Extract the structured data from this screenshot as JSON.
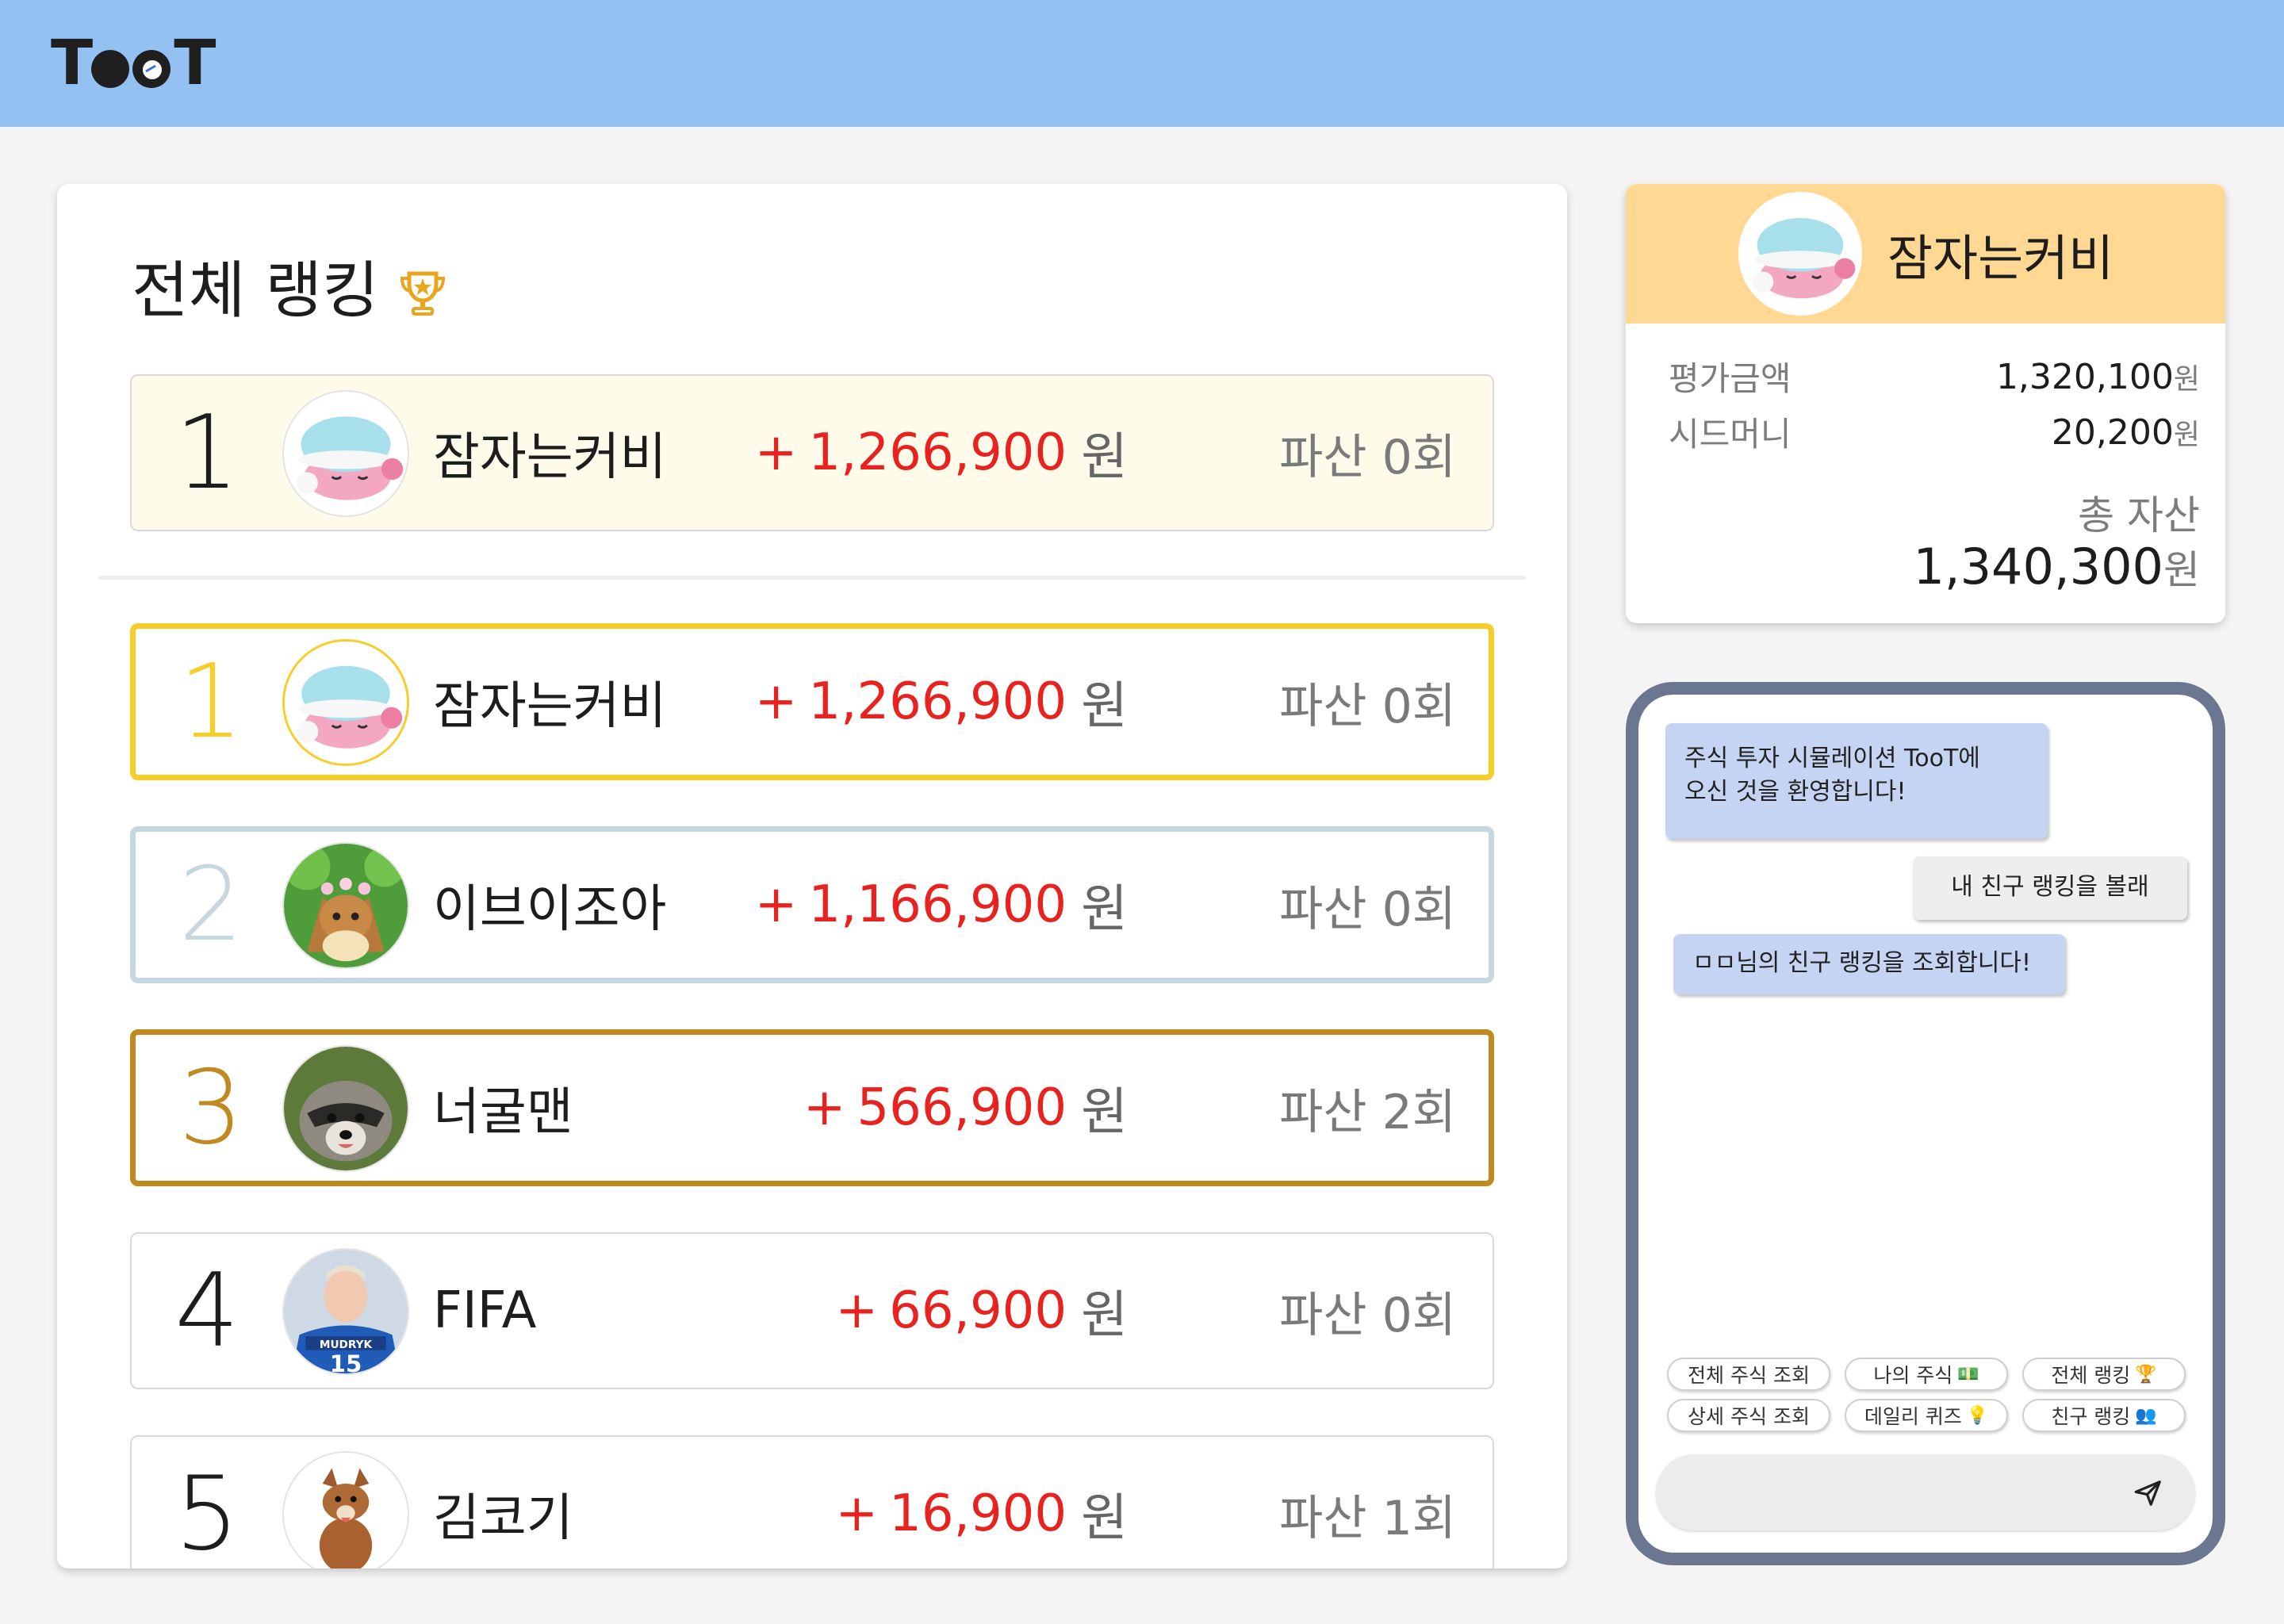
{
  "app": {
    "logo_text": "TooT"
  },
  "ranking": {
    "title": "전체 랭킹",
    "my_rank": {
      "rank": "1",
      "name": "잠자는커비",
      "plus": "+",
      "profit": "1,266,900",
      "unit": "원",
      "bankrupt": "파산 0회"
    },
    "rows": [
      {
        "rank": "1",
        "name": "잠자는커비",
        "plus": "+",
        "profit": "1,266,900",
        "unit": "원",
        "bankrupt": "파산 0회"
      },
      {
        "rank": "2",
        "name": "이브이조아",
        "plus": "+",
        "profit": "1,166,900",
        "unit": "원",
        "bankrupt": "파산 0회"
      },
      {
        "rank": "3",
        "name": "너굴맨",
        "plus": "+",
        "profit": "566,900",
        "unit": "원",
        "bankrupt": "파산 2회"
      },
      {
        "rank": "4",
        "name": "FIFA",
        "plus": "+",
        "profit": "66,900",
        "unit": "원",
        "bankrupt": "파산 0회"
      },
      {
        "rank": "5",
        "name": "김코기",
        "plus": "+",
        "profit": "16,900",
        "unit": "원",
        "bankrupt": "파산 1회"
      }
    ]
  },
  "profile": {
    "name": "잠자는커비",
    "eval_label": "평가금액",
    "eval_value": "1,320,100",
    "seed_label": "시드머니",
    "seed_value": "20,200",
    "unit": "원",
    "total_label": "총 자산",
    "total_value": "1,340,300"
  },
  "chat": {
    "messages": [
      {
        "from": "bot",
        "line1": "주식 투자 시뮬레이션 TooT에",
        "line2": "오신 것을 환영합니다!"
      },
      {
        "from": "me",
        "text": "내 친구 랭킹을 볼래"
      },
      {
        "from": "bot",
        "text": "ㅁㅁ님의 친구 랭킹을 조회합니다!"
      }
    ],
    "chips": [
      {
        "label": "전체 주식 조회",
        "icon": ""
      },
      {
        "label": "나의 주식",
        "icon": "money-icon"
      },
      {
        "label": "전체 랭킹",
        "icon": "trophy-icon"
      },
      {
        "label": "상세 주식 조회",
        "icon": ""
      },
      {
        "label": "데일리 퀴즈",
        "icon": "lightbulb-icon"
      },
      {
        "label": "친구 랭킹",
        "icon": "people-icon"
      }
    ],
    "input_placeholder": ""
  },
  "colors": {
    "header": "#93c1f2",
    "gold": "#f7cd2a",
    "silver": "#c6d7e0",
    "bronze": "#bf8a20",
    "profit": "#e8231f",
    "profile_head": "#ffd994",
    "bot_bubble": "#c5d4f3",
    "chat_border": "#6b7790"
  }
}
